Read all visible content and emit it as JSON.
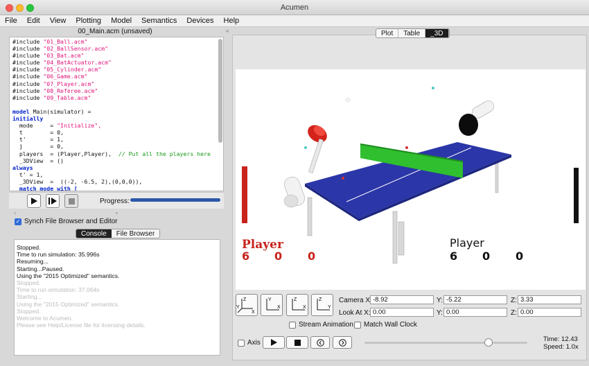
{
  "window": {
    "title": "Acumen"
  },
  "menu": [
    "File",
    "Edit",
    "View",
    "Plotting",
    "Model",
    "Semantics",
    "Devices",
    "Help"
  ],
  "editor": {
    "title": "00_Main.acm (unsaved)",
    "includes": [
      "\"01_Ball.acm\"",
      "\"02_BallSensor.acm\"",
      "\"03_Bat.acm\"",
      "\"04_BatActuator.acm\"",
      "\"05_Cylinder.acm\"",
      "\"06_Game.acm\"",
      "\"07_Player.acm\"",
      "\"08_Referee.acm\"",
      "\"09_Table.acm\""
    ],
    "include_kw": "#include",
    "model_line": "model Main(simulator) =",
    "initially": "initially",
    "init_lines": [
      {
        "name": "mode",
        "val": "\"Initialize\",",
        "type": "str"
      },
      {
        "name": "t",
        "val": "0,",
        "type": "plain"
      },
      {
        "name": "t'",
        "val": "1,",
        "type": "plain"
      },
      {
        "name": "j",
        "val": "0,",
        "type": "plain"
      },
      {
        "name": "players",
        "val": "(Player,Player),",
        "type": "plain",
        "comment": "// Put all the players here"
      },
      {
        "name": "_3DView",
        "val": "()",
        "type": "plain"
      }
    ],
    "always": "always",
    "always_lines": [
      "t' = 1,",
      "_3DView  =  ((-2, -6.5, 2),(0,0,0)),"
    ],
    "match_line": "match mode with ["
  },
  "run_controls": {
    "progress_label": "Progress:",
    "progress": 1.0
  },
  "synch": {
    "label": "Synch File Browser and Editor",
    "checked": true
  },
  "console_tabs": [
    "Console",
    "File Browser"
  ],
  "console": [
    {
      "text": "Stopped.",
      "dim": false
    },
    {
      "text": "Time to run simulation: 35.996s",
      "dim": false
    },
    {
      "text": "Resuming...",
      "dim": false
    },
    {
      "text": "Starting...Paused.",
      "dim": false
    },
    {
      "text": "Using the \"2015 Optimized\" semantics.",
      "dim": false
    },
    {
      "text": "Stopped.",
      "dim": true
    },
    {
      "text": "Time to run simulation: 37.064s",
      "dim": true
    },
    {
      "text": "Starting...",
      "dim": true
    },
    {
      "text": "Using the \"2015 Optimized\" semantics.",
      "dim": true
    },
    {
      "text": "Stopped.",
      "dim": true
    },
    {
      "text": "Welcome to Acumen.",
      "dim": true
    },
    {
      "text": "Please see Help/License file for licensing details.",
      "dim": true
    }
  ],
  "view_tabs": [
    "Plot",
    "Table",
    "_3D"
  ],
  "scene": {
    "left_player": {
      "label": "Player",
      "scores": [
        "6",
        "0",
        "0"
      ],
      "color": "#c8231c"
    },
    "right_player": {
      "label": "Player",
      "scores": [
        "6",
        "0",
        "0"
      ],
      "color": "#111111"
    },
    "table_color": "#2b36a8",
    "net_color": "#2fbf2f"
  },
  "camera": {
    "camera_x_label": "Camera X:",
    "camera_x": "-8.92",
    "camera_y_label": "Y:",
    "camera_y": "-5.22",
    "camera_z_label": "Z:",
    "camera_z": "3.33",
    "look_x_label": "Look At X:",
    "look_x": "0.00",
    "look_y_label": "Y:",
    "look_y": "0.00",
    "look_z_label": "Z:",
    "look_z": "0.00",
    "stream_label": "Stream Animation",
    "match_clock_label": "Match Wall Clock"
  },
  "playback": {
    "axis_label": "Axis",
    "time": "Time: 12.43",
    "speed": "Speed: 1.0x",
    "slider": 0.76
  }
}
